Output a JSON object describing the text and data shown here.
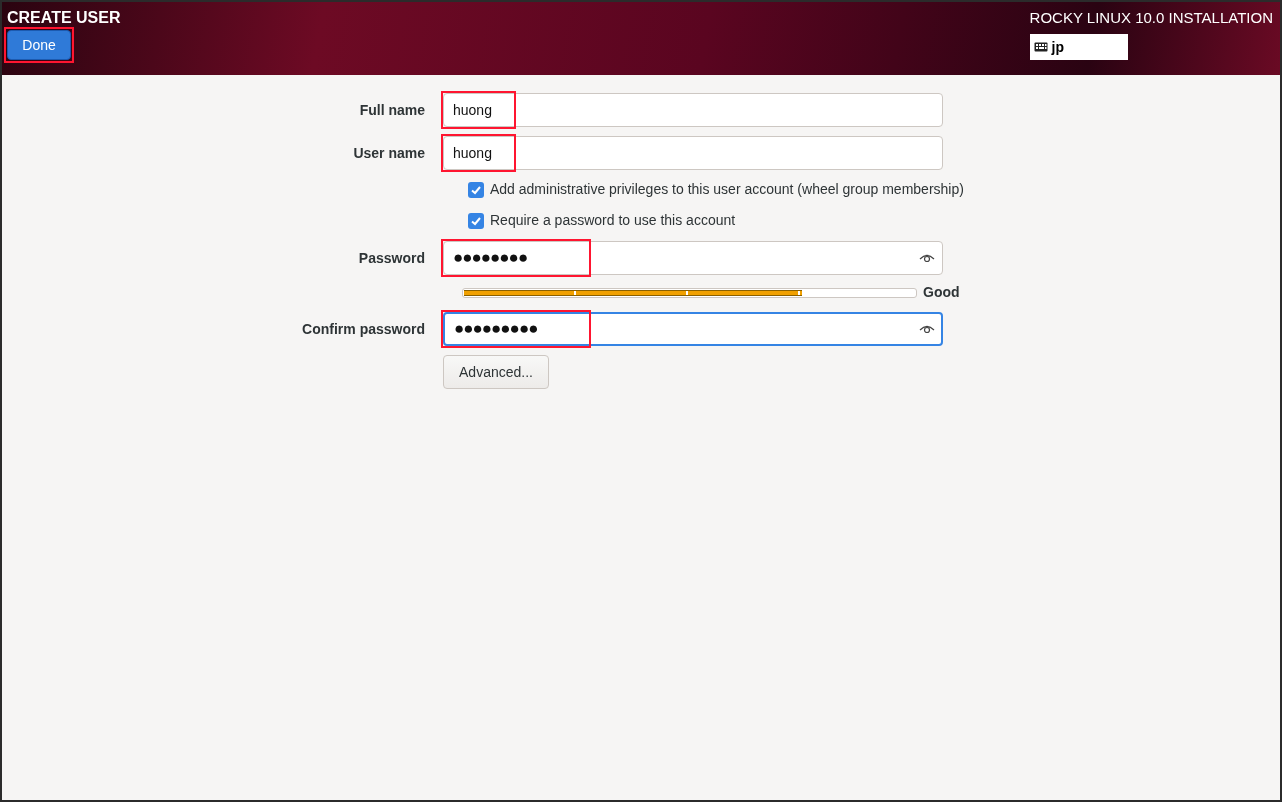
{
  "header": {
    "title": "CREATE USER",
    "done_button": {
      "label": "Done",
      "highlighted": true
    },
    "product": "ROCKY LINUX 10.0 INSTALLATION",
    "keyboard_layout": "jp"
  },
  "fields": [
    {
      "kind": "text",
      "label": "Full name",
      "value": "huong",
      "highlighted": true,
      "focused": false
    },
    {
      "kind": "text",
      "label": "User name",
      "value": "huong",
      "highlighted": true,
      "focused": false
    },
    {
      "kind": "checkbox",
      "label": "Add administrative privileges to this user account (wheel group membership)",
      "checked": true
    },
    {
      "kind": "checkbox",
      "label": "Require a password to use this account",
      "checked": true
    },
    {
      "kind": "password",
      "label": "Password",
      "value": "●●●●●●●●",
      "highlighted": true,
      "focused": false
    },
    {
      "kind": "meter",
      "level": 0.75,
      "reading": "Good"
    },
    {
      "kind": "password",
      "label": "Confirm password",
      "value": "●●●●●●●●●",
      "highlighted": true,
      "focused": true
    },
    {
      "kind": "button",
      "label": "Advanced..."
    }
  ]
}
